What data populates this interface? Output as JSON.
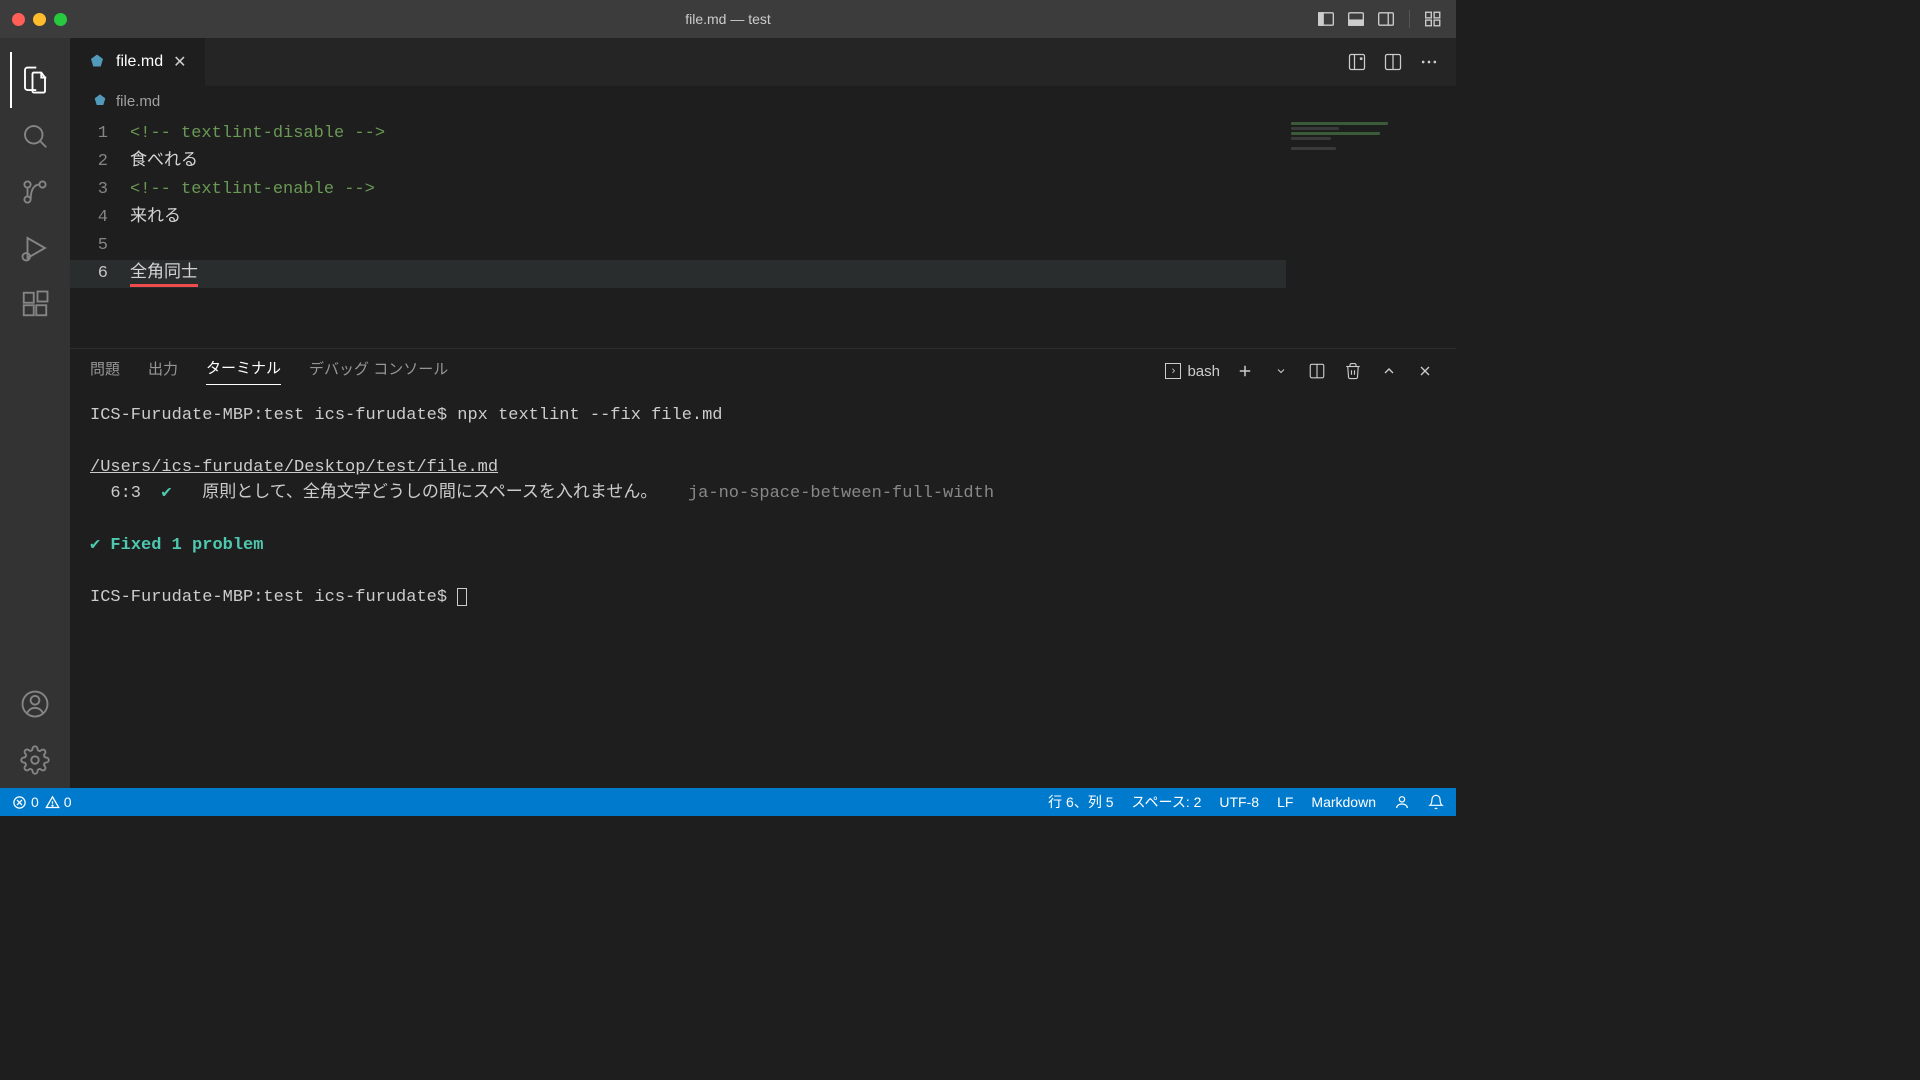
{
  "titlebar": {
    "title": "file.md — test"
  },
  "tab": {
    "filename": "file.md"
  },
  "breadcrumb": {
    "filename": "file.md"
  },
  "editor": {
    "lines": [
      {
        "n": "1",
        "text": "<!-- textlint-disable -->",
        "cls": "comment"
      },
      {
        "n": "2",
        "text": "食べれる",
        "cls": ""
      },
      {
        "n": "3",
        "text": "<!-- textlint-enable -->",
        "cls": "comment"
      },
      {
        "n": "4",
        "text": "来れる",
        "cls": ""
      },
      {
        "n": "5",
        "text": "",
        "cls": ""
      },
      {
        "n": "6",
        "text": "全角同士",
        "cls": "error",
        "current": true
      }
    ]
  },
  "panel": {
    "tabs": {
      "problems": "問題",
      "output": "出力",
      "terminal": "ターミナル",
      "debug": "デバッグ コンソール"
    },
    "shell": "bash"
  },
  "terminal": {
    "prompt1": "ICS-Furudate-MBP:test ics-furudate$ ",
    "command": "npx textlint --fix file.md",
    "filepath": "/Users/ics-furudate/Desktop/test/file.md",
    "loc": "  6:3  ",
    "check": "✔",
    "message": "   原則として、全角文字どうしの間にスペースを入れません。   ",
    "rule": "ja-no-space-between-full-width",
    "fixed": "✔ Fixed 1 problem",
    "prompt2": "ICS-Furudate-MBP:test ics-furudate$ "
  },
  "statusbar": {
    "errors": "0",
    "warnings": "0",
    "cursor": "行 6、列 5",
    "spaces": "スペース: 2",
    "encoding": "UTF-8",
    "eol": "LF",
    "lang": "Markdown"
  }
}
